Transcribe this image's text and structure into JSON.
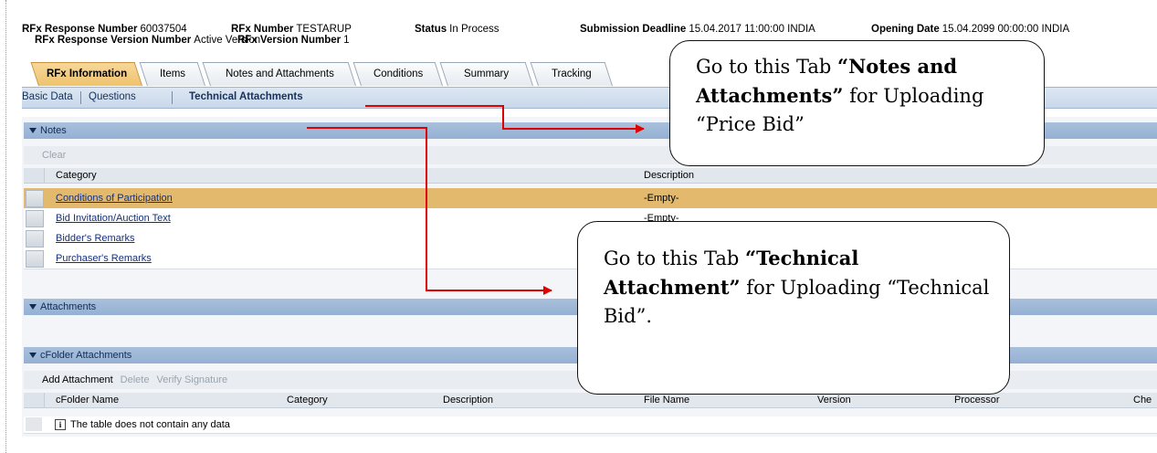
{
  "header": {
    "rfx_response_number_label": "RFx Response Number",
    "rfx_response_number": "60037504",
    "rfx_number_label": "RFx Number",
    "rfx_number": "TESTARUP",
    "status_label": "Status",
    "status": "In Process",
    "submission_deadline_label": "Submission Deadline",
    "submission_deadline": "15.04.2017 11:00:00 INDIA",
    "opening_date_label": "Opening Date",
    "opening_date": "15.04.2099 00:00:00 INDIA",
    "response_version_label": "RFx Response Version Number",
    "response_version": "Active Version",
    "rfx_version_label": "RFx Version Number",
    "rfx_version": "1"
  },
  "tabs": [
    {
      "label": "RFx Information",
      "active": true
    },
    {
      "label": "Items",
      "active": false
    },
    {
      "label": "Notes and Attachments",
      "active": false
    },
    {
      "label": "Conditions",
      "active": false
    },
    {
      "label": "Summary",
      "active": false
    },
    {
      "label": "Tracking",
      "active": false
    }
  ],
  "subnav": {
    "basic_data": "Basic Data",
    "questions": "Questions",
    "technical_attachments": "Technical Attachments"
  },
  "notes": {
    "title": "Notes",
    "toolbar_clear": "Clear",
    "col_category": "Category",
    "col_description": "Description",
    "rows": [
      {
        "category": "Conditions of Participation",
        "description": "-Empty-",
        "highlighted": true
      },
      {
        "category": "Bid Invitation/Auction Text",
        "description": "-Empty-",
        "highlighted": false
      },
      {
        "category": "Bidder's Remarks",
        "description": "",
        "highlighted": false
      },
      {
        "category": "Purchaser's Remarks",
        "description": "",
        "highlighted": false
      }
    ]
  },
  "attachments": {
    "title": "Attachments"
  },
  "cfolder": {
    "title": "cFolder Attachments",
    "toolbar": {
      "add": "Add Attachment",
      "delete": "Delete",
      "verify": "Verify Signature"
    },
    "columns": [
      "cFolder Name",
      "Category",
      "Description",
      "File Name",
      "Version",
      "Processor",
      "Che"
    ],
    "empty_text": "The table does not contain any data"
  },
  "callouts": {
    "notes_prefix": "Go to this Tab ",
    "notes_bold": "“Notes and Attachments”",
    "notes_suffix": " for Uploading “Price Bid”",
    "tech_prefix": "Go to this Tab ",
    "tech_bold": "“Technical Attachment”",
    "tech_suffix": " for Uploading “Technical Bid”."
  },
  "colors": {
    "highlight_row": "#e2b96d",
    "section_bar": "#a9c0dc",
    "active_tab": "#efc36c",
    "arrow": "#e00000",
    "link": "#15307a"
  }
}
